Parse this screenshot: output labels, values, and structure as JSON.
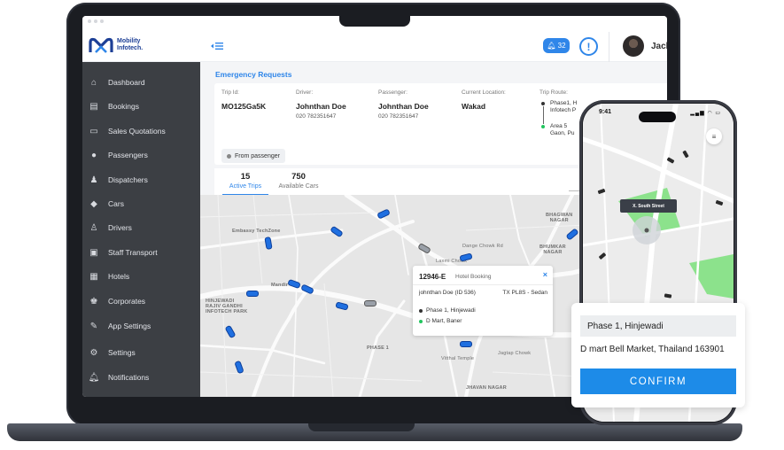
{
  "app": {
    "logo_text": "Mobility Infotech.",
    "notification_count": "32",
    "alert_symbol": "!",
    "user_name": "Jack"
  },
  "sidebar": {
    "items": [
      {
        "label": "Dashboard",
        "icon": "home-icon"
      },
      {
        "label": "Bookings",
        "icon": "bookings-icon"
      },
      {
        "label": "Sales Quotations",
        "icon": "quotation-icon"
      },
      {
        "label": "Passengers",
        "icon": "passenger-icon"
      },
      {
        "label": "Dispatchers",
        "icon": "dispatcher-icon"
      },
      {
        "label": "Cars",
        "icon": "car-tag-icon"
      },
      {
        "label": "Drivers",
        "icon": "driver-icon"
      },
      {
        "label": "Staff Transport",
        "icon": "bus-icon"
      },
      {
        "label": "Hotels",
        "icon": "hotel-icon"
      },
      {
        "label": "Corporates",
        "icon": "corporate-icon"
      },
      {
        "label": "App Settings",
        "icon": "edit-icon"
      },
      {
        "label": "Settings",
        "icon": "gear-icon"
      },
      {
        "label": "Notifications",
        "icon": "bell-icon"
      }
    ]
  },
  "emergency": {
    "title": "Emergency Requests",
    "trip_id_label": "Trip Id:",
    "trip_id": "MO125Ga5K",
    "driver_label": "Driver:",
    "driver_name": "Johnthan Doe",
    "driver_phone": "020 782351647",
    "passenger_label": "Passenger:",
    "passenger_name": "Johnthan Doe",
    "passenger_phone": "020 782351647",
    "location_label": "Current Location:",
    "location": "Wakad",
    "route_label": "Trip Route:",
    "route_from_line1": "Phase1, H",
    "route_from_line2": "Infotech P",
    "route_to_line1": "Area 5",
    "route_to_line2": "Gaon, Pu",
    "source_chip": "From passenger"
  },
  "stats": {
    "active_trips_count": "15",
    "active_trips_label": "Active Trips",
    "available_cars_count": "750",
    "available_cars_label": "Available Cars"
  },
  "map": {
    "labels": {
      "embassy": "Embassy TechZone",
      "mandir": "Mandir",
      "hinjewadi": "HINJEWADI\nRAJIV GANDHI\nINFOTECH PARK",
      "bhagwan": "BHAGWAN\nNAGAR",
      "bhumkar": "BHUMKAR\nNAGAR",
      "phase1": "PHASE 1",
      "jhavan": "JHAVAN NAGAR",
      "chowk": "Laxmi Chowk",
      "dange": "Dange Chowk Rd",
      "vitthal": "Vitthal Temple",
      "jagtap": "Jagtap Chowk"
    }
  },
  "popup": {
    "code": "12946-E",
    "kind": "Hotel Booking",
    "driver": "johnthan Doe (ID 536)",
    "vehicle": "TX PL8S - Sedan",
    "pickup": "Phase 1, Hinjewadi",
    "drop": "D Mart, Baner",
    "close": "×"
  },
  "phone": {
    "time": "9:41",
    "status_icons": "▂▄▆ ◠ ▭",
    "street_tag": "X. South Street",
    "pickup": "Phase 1, Hinjewadi",
    "drop": "D mart Bell Market, Thailand 163901",
    "confirm_label": "CONFIRM"
  },
  "colors": {
    "accent": "#2f86e9",
    "sidebar": "#3c3f44",
    "confirm": "#1d8be8",
    "park": "#7be07b"
  }
}
